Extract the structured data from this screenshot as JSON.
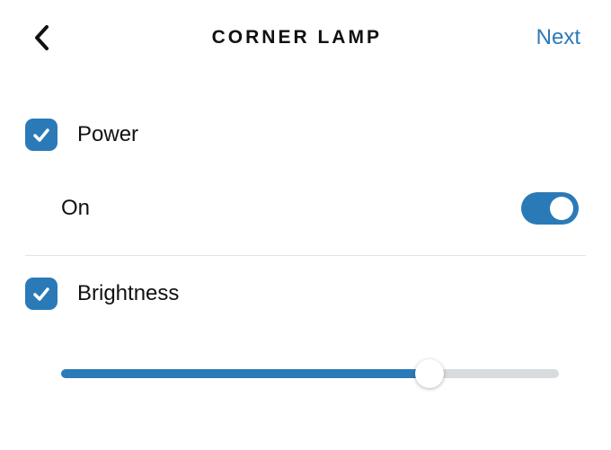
{
  "header": {
    "title": "CORNER LAMP",
    "next_label": "Next"
  },
  "power": {
    "label": "Power",
    "checked": true,
    "state_label": "On",
    "toggle_on": true
  },
  "brightness": {
    "label": "Brightness",
    "checked": true,
    "value_percent": 74
  },
  "colors": {
    "accent": "#2b7ab8"
  }
}
